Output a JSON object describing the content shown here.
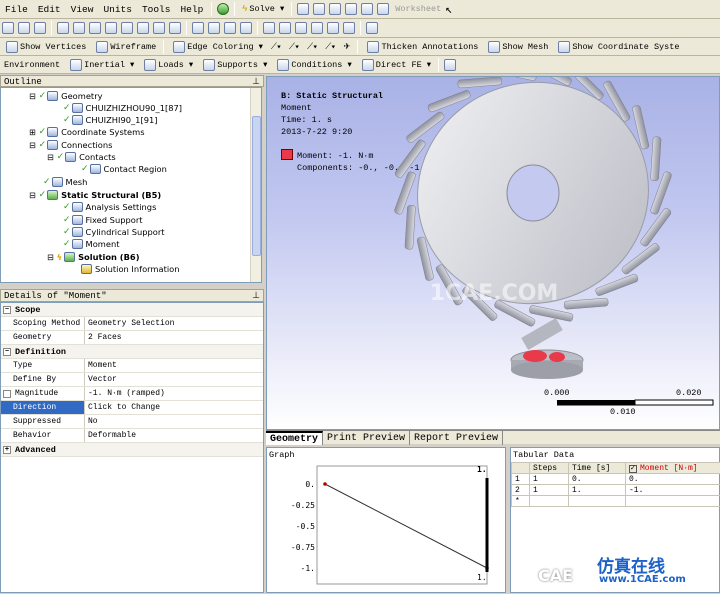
{
  "menu": [
    "File",
    "Edit",
    "View",
    "Units",
    "Tools",
    "Help"
  ],
  "toolbar2": {
    "solve": "Solve",
    "worksheet": "Worksheet"
  },
  "toolbar3": {
    "show_vertices": "Show Vertices",
    "wireframe": "Wireframe",
    "edge_coloring": "Edge Coloring",
    "thicken": "Thicken Annotations",
    "show_mesh": "Show Mesh",
    "show_coord": "Show Coordinate Syste"
  },
  "toolbar4": {
    "environment": "Environment",
    "inertial": "Inertial",
    "loads": "Loads",
    "supports": "Supports",
    "conditions": "Conditions",
    "direct_fe": "Direct FE"
  },
  "outline": {
    "title": "Outline",
    "pin": "ᵖ",
    "items": [
      {
        "label": "Geometry",
        "bold": false
      },
      {
        "label": "CHUIZHIZHOU90_1[87]",
        "bold": false
      },
      {
        "label": "CHUIZHI90_1[91]",
        "bold": false
      },
      {
        "label": "Coordinate Systems",
        "bold": false
      },
      {
        "label": "Connections",
        "bold": false
      },
      {
        "label": "Contacts",
        "bold": false
      },
      {
        "label": "Contact Region",
        "bold": false
      },
      {
        "label": "Mesh",
        "bold": false
      },
      {
        "label": "Static Structural (B5)",
        "bold": true
      },
      {
        "label": "Analysis Settings",
        "bold": false
      },
      {
        "label": "Fixed Support",
        "bold": false
      },
      {
        "label": "Cylindrical Support",
        "bold": false
      },
      {
        "label": "Moment",
        "bold": false
      },
      {
        "label": "Solution (B6)",
        "bold": true
      },
      {
        "label": "Solution Information",
        "bold": false
      }
    ]
  },
  "details": {
    "title": "Details of \"Moment\"",
    "sections": {
      "scope": "Scope",
      "definition": "Definition",
      "advanced": "Advanced"
    },
    "rows": {
      "scoping_method": {
        "k": "Scoping Method",
        "v": "Geometry Selection"
      },
      "geometry": {
        "k": "Geometry",
        "v": "2 Faces"
      },
      "type": {
        "k": "Type",
        "v": "Moment"
      },
      "define_by": {
        "k": "Define By",
        "v": "Vector"
      },
      "magnitude": {
        "k": "Magnitude",
        "v": "-1. N·m  (ramped)"
      },
      "direction": {
        "k": "Direction",
        "v": "Click to Change"
      },
      "suppressed": {
        "k": "Suppressed",
        "v": "No"
      },
      "behavior": {
        "k": "Behavior",
        "v": "Deformable"
      }
    }
  },
  "viewport": {
    "title": "B: Static Structural",
    "line1": "Moment",
    "line2": "Time: 1. s",
    "line3": "2013-7-22 9:20",
    "legend_moment": "Moment: -1. N·m",
    "legend_components": "Components: -0., -0., -1. N·m",
    "scale_labels": [
      "0.000",
      "0.020",
      "0.010"
    ],
    "legend_color": "#e83a4a"
  },
  "tabs": [
    "Geometry",
    "Print Preview",
    "Report Preview"
  ],
  "graph": {
    "title": "Graph",
    "top_right": "1.",
    "bottom_right": "1.",
    "ticks": [
      "0.",
      "-0.25",
      "-0.5",
      "-0.75",
      "-1."
    ]
  },
  "tabular": {
    "title": "Tabular Data",
    "headers": [
      "Steps",
      "Time [s]",
      "Moment [N·m]"
    ],
    "rows": [
      [
        "1",
        "1",
        "0.",
        "0."
      ],
      [
        "2",
        "1",
        "1.",
        "-1."
      ]
    ],
    "new_row": "*"
  },
  "chart_data": {
    "type": "line",
    "x": [
      0,
      1
    ],
    "series": [
      {
        "values": [
          0,
          -1
        ]
      }
    ],
    "ylim": [
      -1,
      0
    ]
  },
  "watermark": {
    "logo": "1CAE.COM",
    "bottom": "CAE",
    "cn": "仿真在线",
    "url": "www.1CAE.com"
  }
}
